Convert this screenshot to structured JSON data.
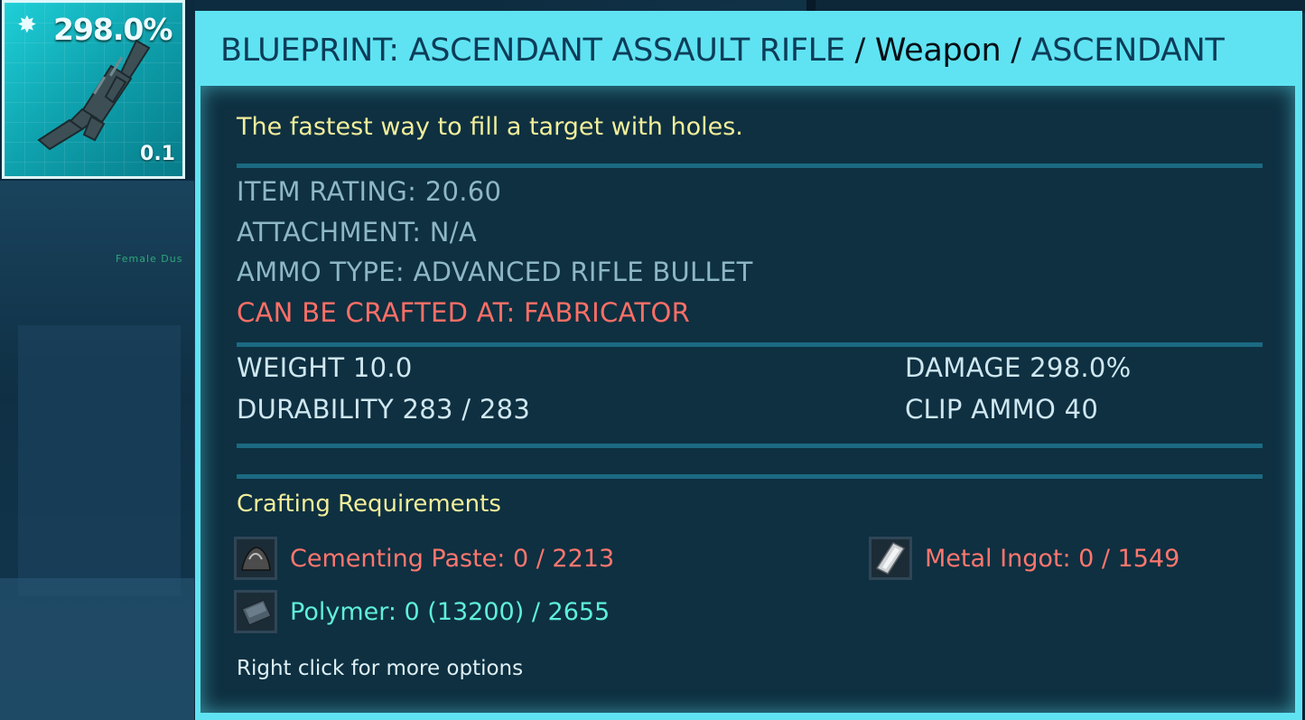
{
  "slot": {
    "quality": "298.0%",
    "weight": "0.1",
    "icon": "assault-rifle-icon"
  },
  "tooltip": {
    "title_name": "BLUEPRINT: ASCENDANT ASSAULT RIFLE",
    "title_type": "Weapon",
    "title_quality": "ASCENDANT",
    "title_separator": "/",
    "description": "The fastest way to fill a target with holes.",
    "item_rating": "ITEM RATING: 20.60",
    "attachment": "ATTACHMENT: N/A",
    "ammo_type": "AMMO TYPE: ADVANCED RIFLE BULLET",
    "crafted_at": "CAN BE CRAFTED AT: FABRICATOR",
    "weight": "WEIGHT 10.0",
    "durability": "DURABILITY 283 / 283",
    "damage": "DAMAGE 298.0%",
    "clip_ammo": "CLIP AMMO 40",
    "crafting_title": "Crafting Requirements",
    "requirements": [
      {
        "label": "Cementing Paste: 0 / 2213",
        "icon": "cementing-paste-icon",
        "status": "insufficient"
      },
      {
        "label": "Metal Ingot: 0 / 1549",
        "icon": "metal-ingot-icon",
        "status": "insufficient"
      },
      {
        "label": "Polymer: 0 (13200) / 2655",
        "icon": "polymer-icon",
        "status": "available"
      }
    ],
    "hint": "Right click for more options"
  },
  "background": {
    "label_female": "Female Dus"
  },
  "colors": {
    "tooltip_frame": "#5fe3f2",
    "panel_bg": "#082234",
    "description": "#f2ee9a",
    "stat_muted": "#8eb7c6",
    "stat_red": "#ff6f66",
    "resource_red": "#ff766e",
    "resource_cyan": "#5ff0d8"
  }
}
